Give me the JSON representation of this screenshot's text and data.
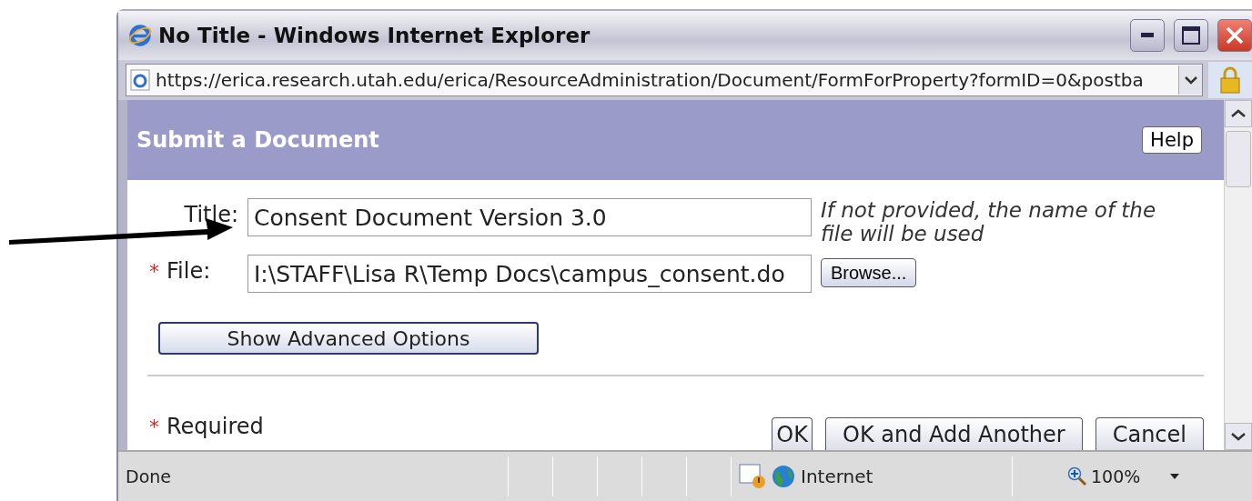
{
  "window": {
    "title": "No Title - Windows Internet Explorer"
  },
  "address_bar": {
    "url": "https://erica.research.utah.edu/erica/ResourceAdministration/Document/FormForProperty?formID=0&postba"
  },
  "header": {
    "title": "Submit a Document",
    "help_button": "Help"
  },
  "form": {
    "fields": [
      {
        "kind": "text",
        "label": "Title:",
        "value": "Consent Document Version 3.0",
        "hint": "If not provided, the name of the file will be used"
      },
      {
        "kind": "file",
        "mark": "*",
        "label": "File:",
        "value": "I:\\STAFF\\Lisa R\\Temp Docs\\campus_consent.do",
        "browse_button": "Browse..."
      }
    ],
    "advanced_button": "Show Advanced Options",
    "legend": {
      "mark": "*",
      "text": "Required"
    },
    "buttons": [
      "OK",
      "OK and Add Another",
      "Cancel"
    ]
  },
  "status_bar": {
    "text": "Done",
    "zone": "Internet",
    "zoom": "100%"
  }
}
